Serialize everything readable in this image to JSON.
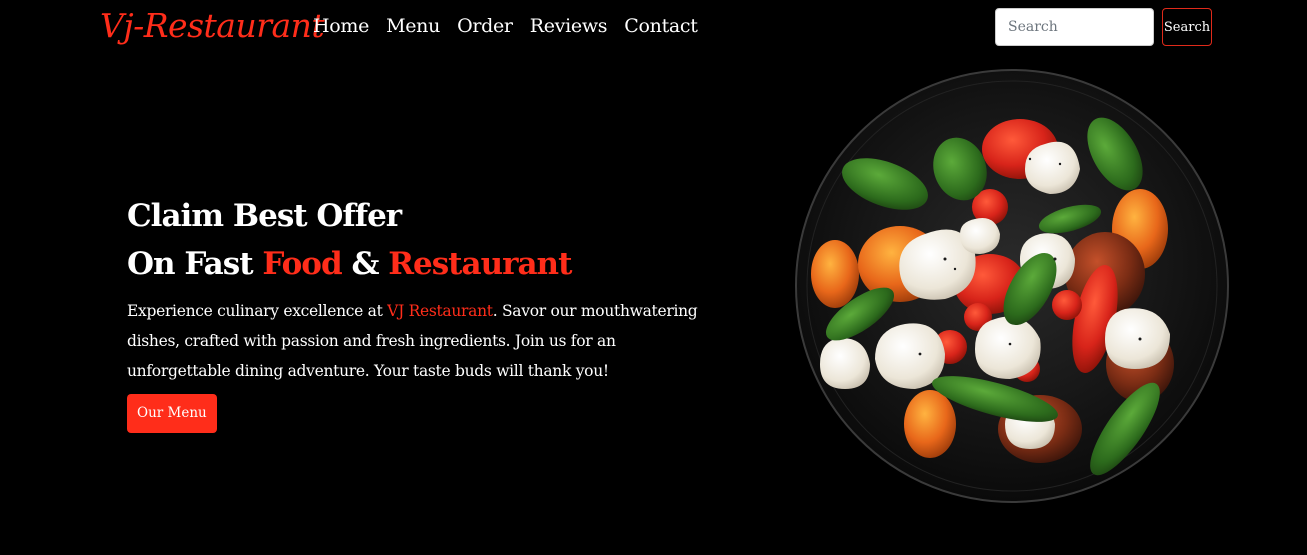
{
  "brand": "Vj-Restaurant",
  "nav": [
    "Home",
    "Menu",
    "Order",
    "Reviews",
    "Contact"
  ],
  "search": {
    "placeholder": "Search",
    "button_label": "Search"
  },
  "hero": {
    "title_line1": "Claim Best Offer",
    "title_line2_prefix": "On Fast ",
    "title_food": "Food",
    "title_amp": " & ",
    "title_restaurant": "Restaurant",
    "desc_prefix": "Experience culinary excellence at ",
    "desc_highlight": "VJ Restaurant",
    "desc_suffix": ". Savor our mouthwatering dishes, crafted with passion and fresh ingredients. Join us for an unforgettable dining adventure. Your taste buds will thank you!",
    "button_label": "Our Menu"
  },
  "colors": {
    "accent": "#ff2d1a",
    "background": "#000000",
    "text": "#ffffff"
  },
  "image": {
    "alt": "caprese-salad-plate"
  }
}
